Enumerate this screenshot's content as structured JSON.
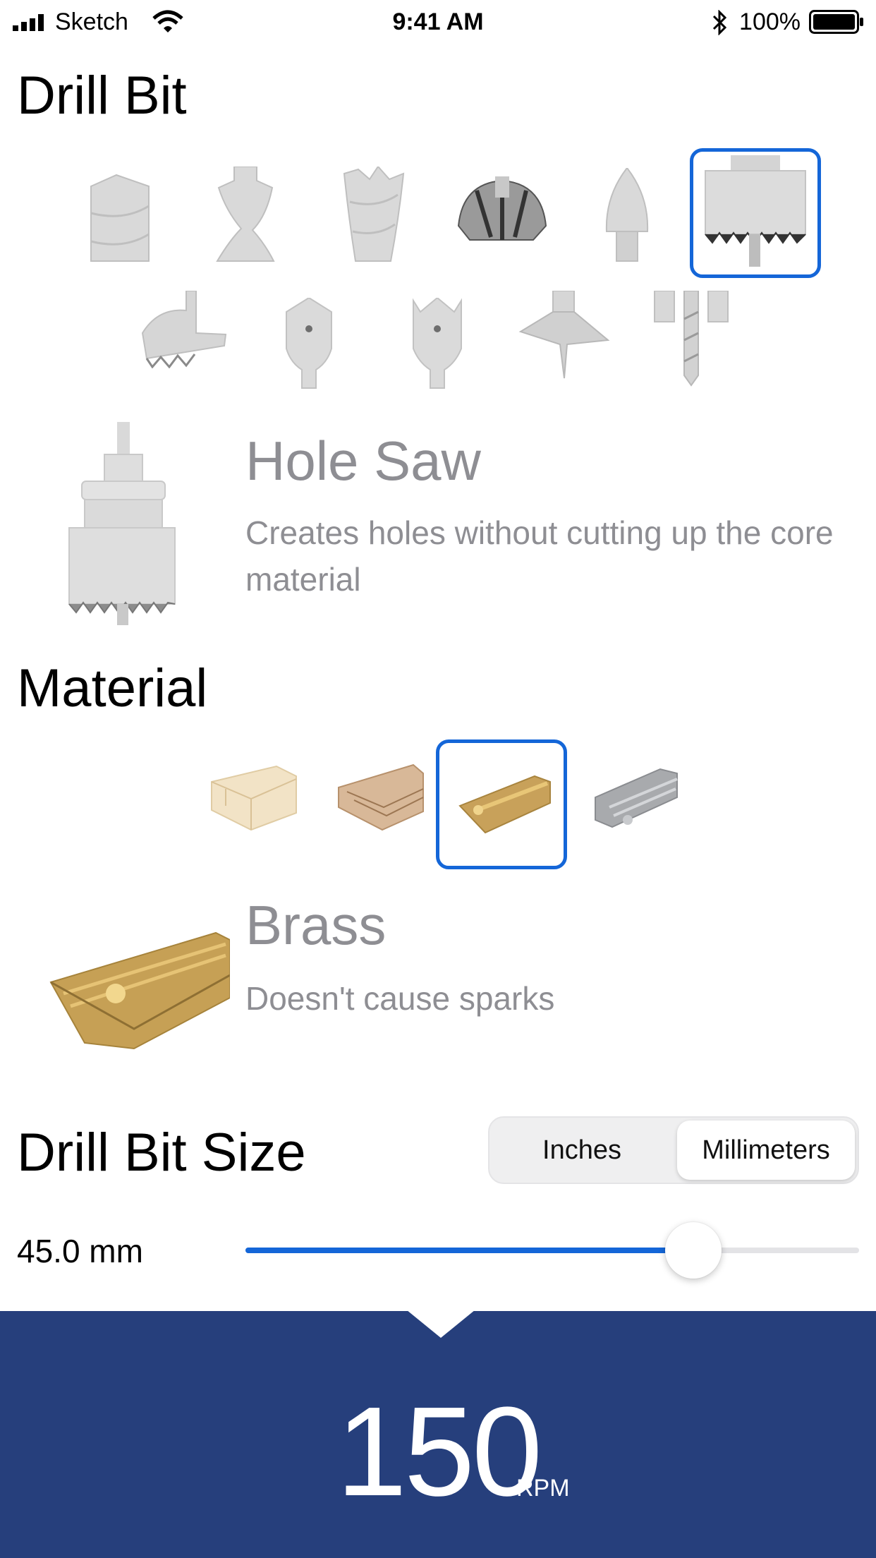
{
  "status_bar": {
    "carrier": "Sketch",
    "time": "9:41 AM",
    "battery": "100%"
  },
  "drill_bit": {
    "section_title": "Drill Bit",
    "options": [
      {
        "icon": "twist-bit-icon"
      },
      {
        "icon": "brad-point-bit-icon"
      },
      {
        "icon": "auger-bit-icon"
      },
      {
        "icon": "forstner-bit-icon"
      },
      {
        "icon": "countersink-bit-icon"
      },
      {
        "icon": "hole-saw-bit-icon",
        "selected": true
      },
      {
        "icon": "adjustable-bit-icon"
      },
      {
        "icon": "spade-bit-icon"
      },
      {
        "icon": "spade-bit-spurs-icon"
      },
      {
        "icon": "step-drill-bit-icon"
      },
      {
        "icon": "masonry-bit-icon"
      }
    ],
    "selected_name": "Hole Saw",
    "selected_description": "Creates holes without cutting up the core material"
  },
  "material": {
    "section_title": "Material",
    "options": [
      {
        "icon": "softwood-icon"
      },
      {
        "icon": "hardwood-icon"
      },
      {
        "icon": "brass-icon",
        "selected": true
      },
      {
        "icon": "aluminum-icon"
      }
    ],
    "selected_name": "Brass",
    "selected_description": "Doesn't cause sparks"
  },
  "size": {
    "section_title": "Drill Bit Size",
    "unit_options": [
      "Inches",
      "Millimeters"
    ],
    "selected_unit": "Millimeters",
    "value_label": "45.0 mm",
    "slider_fraction": 0.73
  },
  "result": {
    "value": "150",
    "unit": "RPM"
  },
  "colors": {
    "accent": "#1466d8",
    "panel": "#263f7c",
    "secondary_text": "#8e8e93"
  }
}
